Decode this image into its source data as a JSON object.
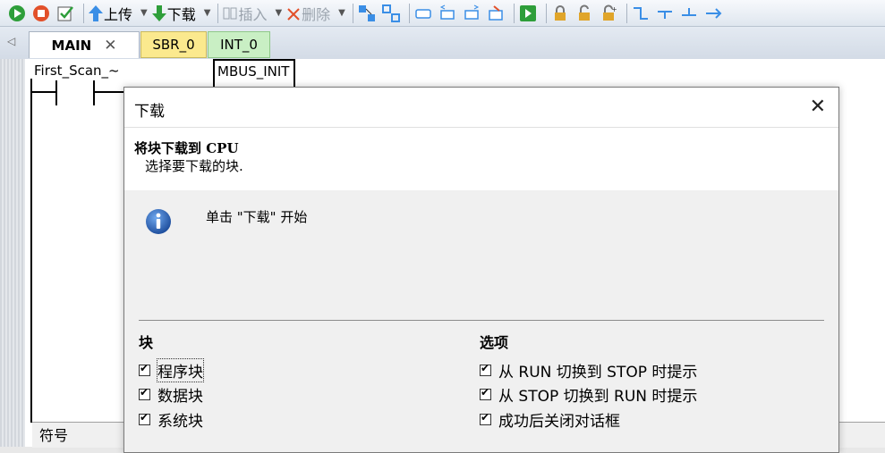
{
  "toolbar": {
    "upload_label": "上传",
    "download_label": "下载",
    "insert_label": "插入",
    "delete_label": "删除"
  },
  "tabs": [
    {
      "label": "MAIN",
      "active": true
    },
    {
      "label": "SBR_0",
      "color": "#fbe98e"
    },
    {
      "label": "INT_0",
      "color": "#c9efc4"
    }
  ],
  "editor": {
    "contact_label": "First_Scan_~",
    "block_label": "MBUS_INIT",
    "symbol_panel_label": "符号"
  },
  "dialog": {
    "title": "下载",
    "header_title": "将块下载到  CPU",
    "header_subtitle": "选择要下载的块.",
    "info_message": "单击 \"下载\" 开始",
    "blocks_group": {
      "title": "块",
      "items": [
        {
          "label": "程序块",
          "checked": true
        },
        {
          "label": "数据块",
          "checked": true
        },
        {
          "label": "系统块",
          "checked": true
        }
      ]
    },
    "options_group": {
      "title": "选项",
      "items": [
        {
          "label": "从 RUN 切换到 STOP 时提示",
          "checked": true
        },
        {
          "label": "从 STOP 切换到 RUN 时提示",
          "checked": true
        },
        {
          "label": "成功后关闭对话框",
          "checked": true
        }
      ]
    }
  },
  "colors": {
    "accent_blue": "#1e6fd0",
    "run_green": "#2e9e3a",
    "stop_red": "#e2502a"
  }
}
